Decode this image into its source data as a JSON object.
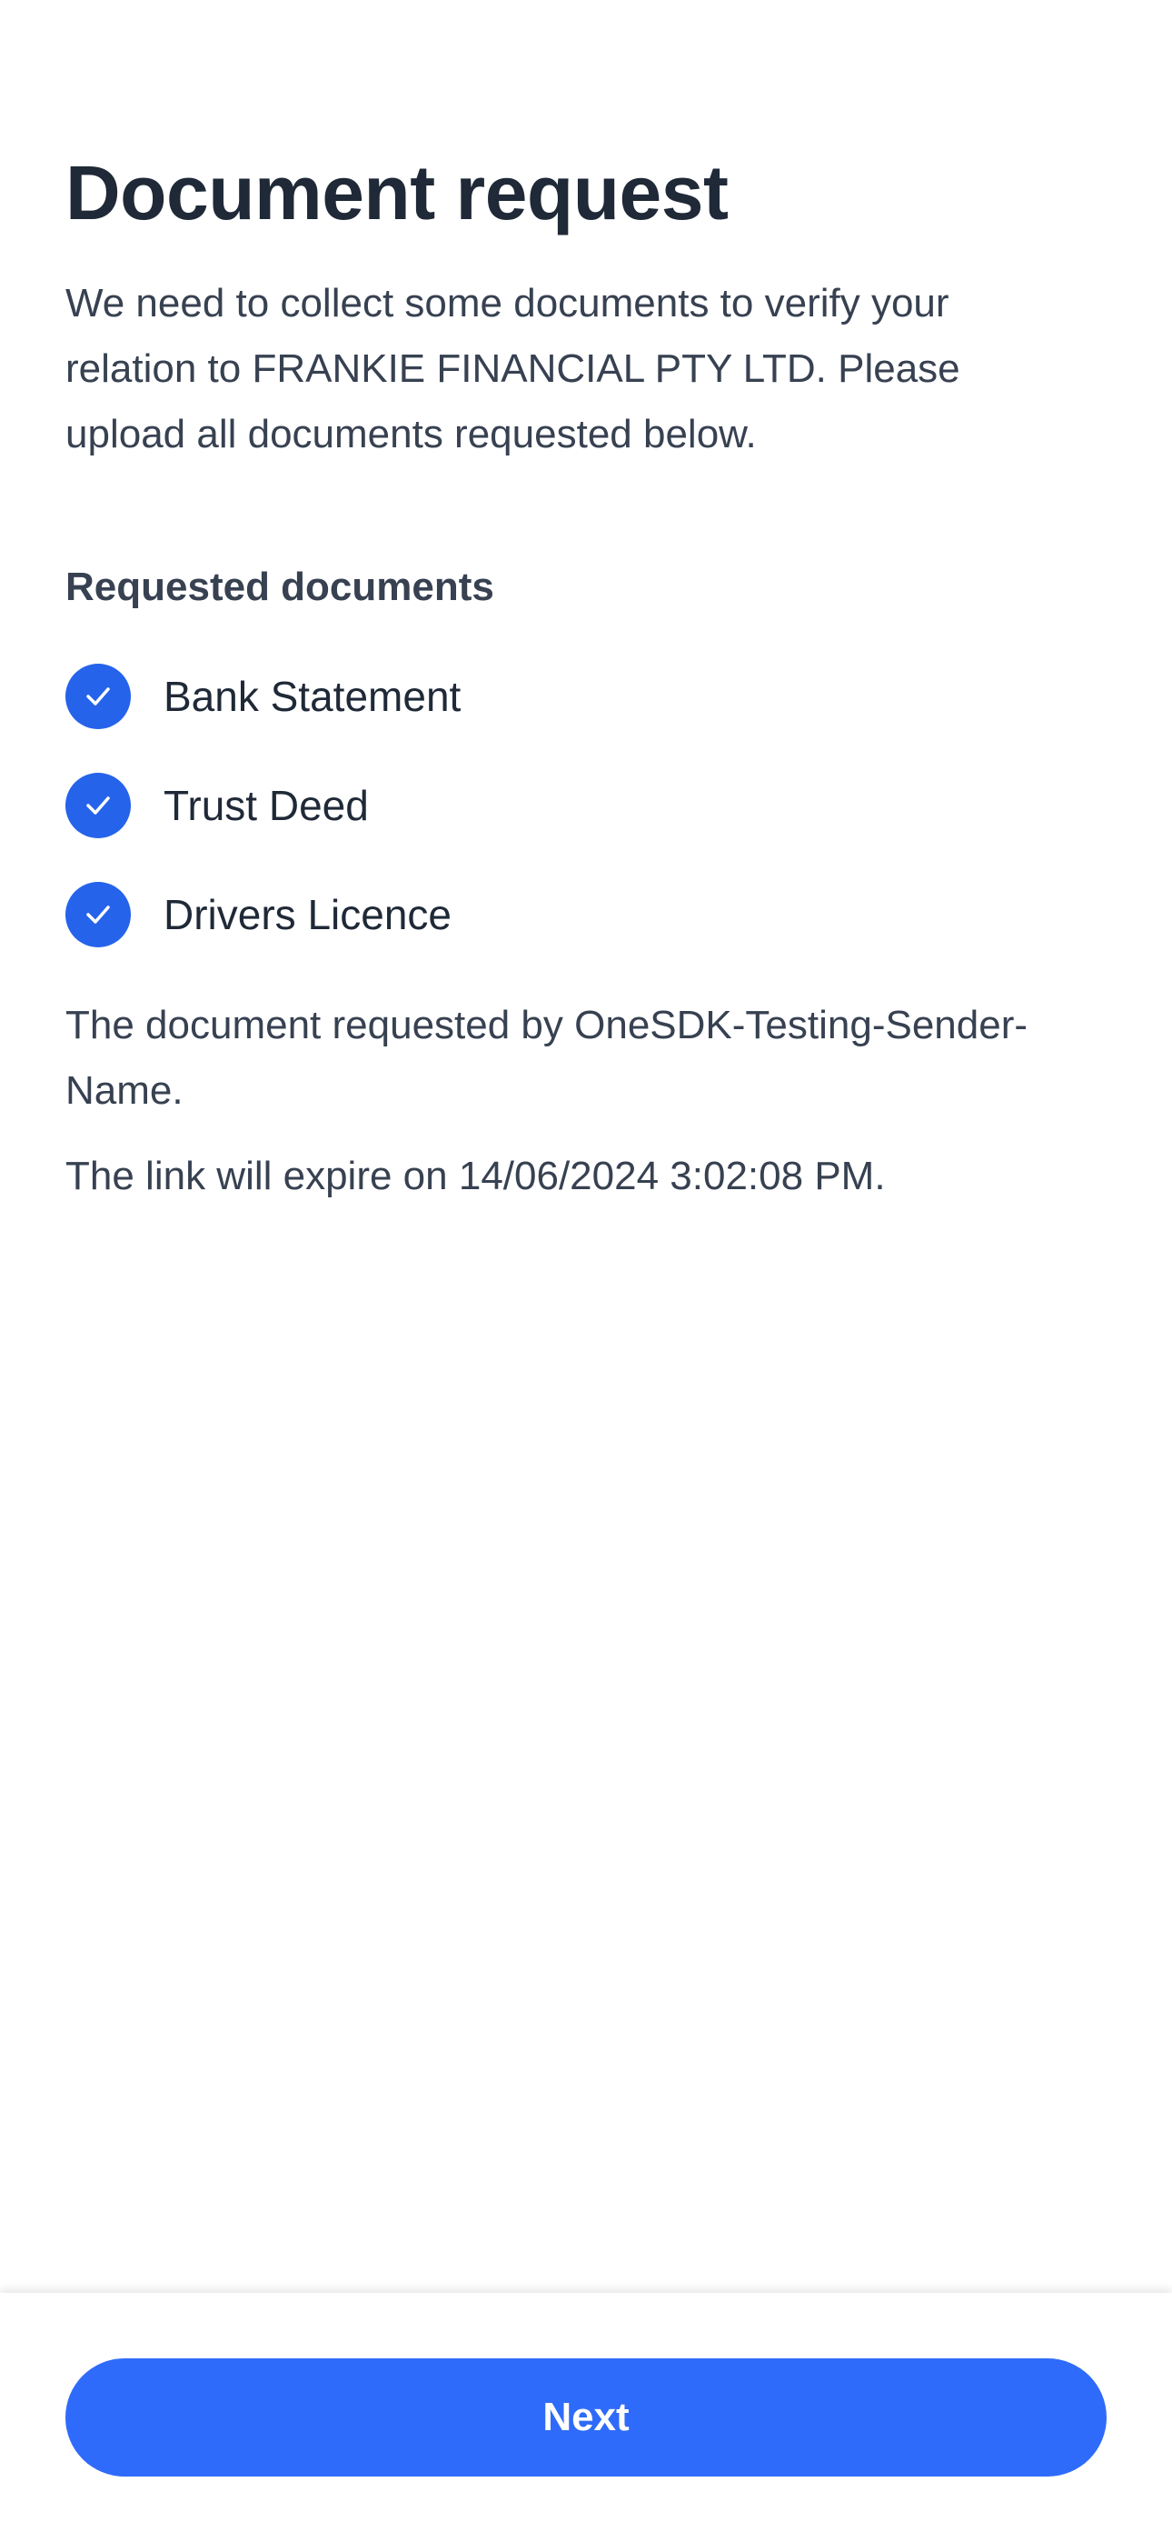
{
  "page": {
    "title": "Document request",
    "intro": "We need to collect some documents to verify your relation to FRANKIE FINANCIAL PTY LTD. Please upload all documents requested below."
  },
  "requested_documents": {
    "heading": "Requested documents",
    "items": [
      {
        "label": "Bank Statement",
        "icon": "check-circle-icon"
      },
      {
        "label": "Trust Deed",
        "icon": "check-circle-icon"
      },
      {
        "label": "Drivers Licence",
        "icon": "check-circle-icon"
      }
    ]
  },
  "info": {
    "requested_by": "The document requested by OneSDK-Testing-Sender-Name.",
    "expiry": "The link will expire on 14/06/2024 3:02:08 PM."
  },
  "footer": {
    "next_label": "Next"
  },
  "colors": {
    "accent": "#2f6bfa",
    "check": "#2563eb",
    "title_text": "#1f2937",
    "body_text": "#374151"
  }
}
